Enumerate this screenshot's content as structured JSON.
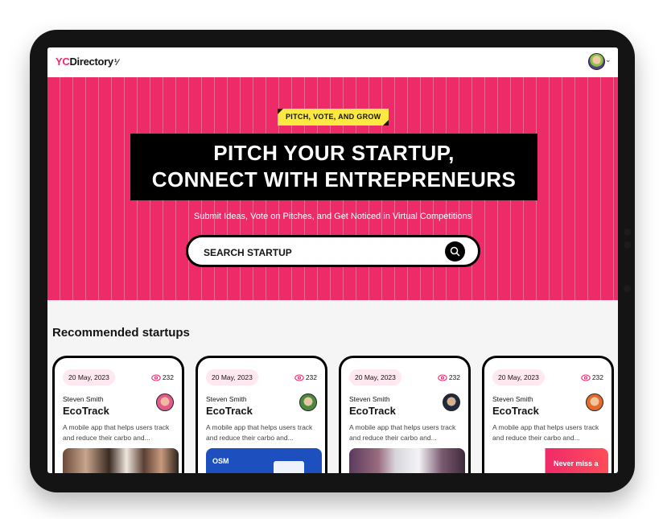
{
  "brand": {
    "yc": "YC",
    "name": "Directory",
    "spark": "¹⁄"
  },
  "user": {
    "avatar": "avatar",
    "chevron": "⌄"
  },
  "hero": {
    "tag": "PITCH, VOTE, AND GROW",
    "headline_line1": "PITCH YOUR STARTUP,",
    "headline_line2": "CONNECT WITH ENTREPRENEURS",
    "subheading": "Submit Ideas, Vote on Pitches, and Get Noticed in Virtual Competitions",
    "search_placeholder": "SEARCH STARTUP"
  },
  "section": {
    "title": "Recommended startups"
  },
  "cards": [
    {
      "date": "20 May, 2023",
      "views": "232",
      "author": "Steven Smith",
      "title": "EcoTrack",
      "description": "A mobile app that helps users track and reduce their carbo and..."
    },
    {
      "date": "20 May, 2023",
      "views": "232",
      "author": "Steven Smith",
      "title": "EcoTrack",
      "description": "A mobile app that helps users track and reduce their carbo and...",
      "thumb_text": "OSM"
    },
    {
      "date": "20 May, 2023",
      "views": "232",
      "author": "Steven Smith",
      "title": "EcoTrack",
      "description": "A mobile app that helps users track and reduce their carbo and..."
    },
    {
      "date": "20 May, 2023",
      "views": "232",
      "author": "Steven Smith",
      "title": "EcoTrack",
      "description": "A mobile app that helps users track and reduce their carbo and...",
      "thumb_text": "Never miss a"
    }
  ],
  "colors": {
    "primary": "#ee2b69",
    "secondary": "#fbe843",
    "dark": "#141413"
  }
}
